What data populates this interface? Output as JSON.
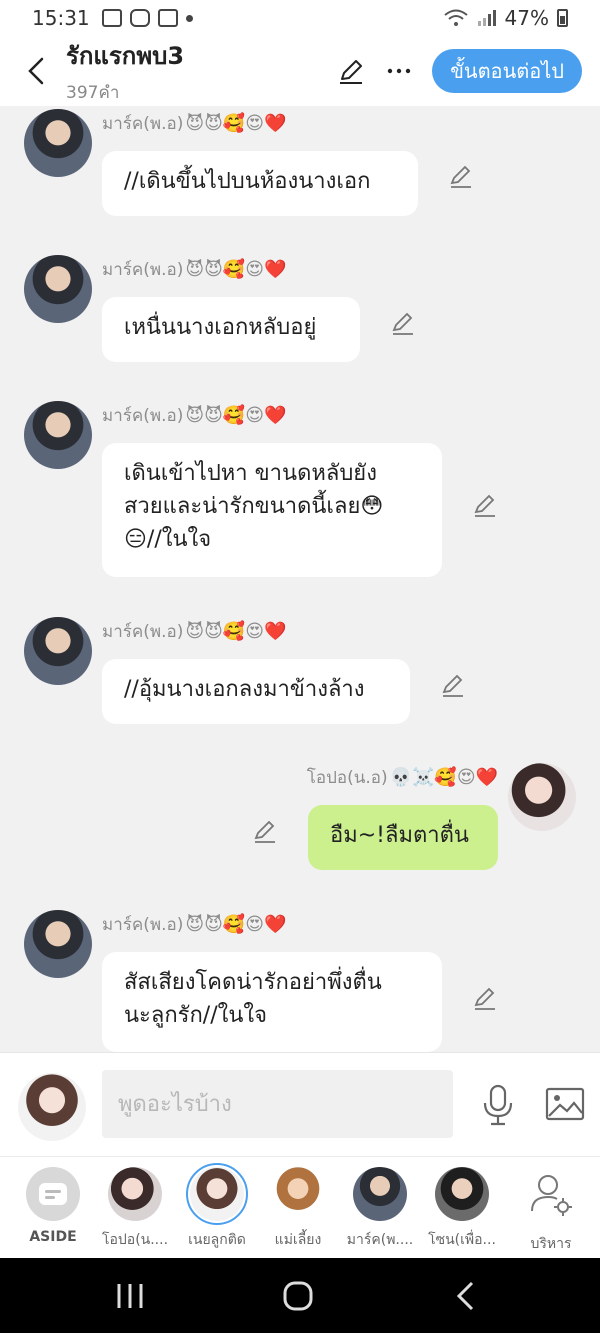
{
  "status_bar": {
    "time": "15:31",
    "battery": "47%",
    "icons": [
      "gallery-icon",
      "media-icon",
      "record-icon",
      "dot-icon",
      "wifi-icon",
      "signal-icon",
      "battery-icon"
    ]
  },
  "header": {
    "title": "รักแรกพบ3",
    "subtitle": "397คำ",
    "next_label": "ขั้นตอนต่อไป"
  },
  "messages": [
    {
      "sender": "มาร์ค(พ.อ)",
      "emojis": "😈😈🥰😍❤️",
      "side": "left",
      "text": "//เดินขึ้นไปบนห้องนางเอก"
    },
    {
      "sender": "มาร์ค(พ.อ)",
      "emojis": "😈😈🥰😍❤️",
      "side": "left",
      "text": "เหนื่นนางเอกหลับอยู่"
    },
    {
      "sender": "มาร์ค(พ.อ)",
      "emojis": "😈😈🥰😍❤️",
      "side": "left",
      "text": "เดินเข้าไปหา ขานดหลับยัง\nสวยและน่ารักขนาดนี้เลย😳\n😑//ในใจ"
    },
    {
      "sender": "มาร์ค(พ.อ)",
      "emojis": "😈😈🥰😍❤️",
      "side": "left",
      "text": "//อุ้มนางเอกลงมาข้างล้าง"
    },
    {
      "sender": "โอปอ(น.อ)",
      "emojis": "💀☠️🥰😍❤️",
      "side": "right",
      "text": "อืม~!ลืมตาตื่น"
    },
    {
      "sender": "มาร์ค(พ.อ)",
      "emojis": "😈😈🥰😍❤️",
      "side": "left",
      "text": "สัสเสียงโคดน่ารักอย่าพึ่งตื่น\nนะลูกรัก//ในใจ"
    }
  ],
  "input": {
    "placeholder": "พูดอะไรบ้าง",
    "value": ""
  },
  "characters": [
    {
      "label": "ASIDE"
    },
    {
      "label": "โอปอ(น...."
    },
    {
      "label": "เนยลูกติด"
    },
    {
      "label": "แม่เลี้ยง"
    },
    {
      "label": "มาร์ค(พ...."
    },
    {
      "label": "โซน(เพื่อ..."
    },
    {
      "label": "บริหาร"
    }
  ],
  "colors": {
    "accent": "#4a9fef",
    "mine_bubble": "#cdf08f",
    "other_bubble": "#ffffff",
    "background": "#f1f1f1"
  }
}
